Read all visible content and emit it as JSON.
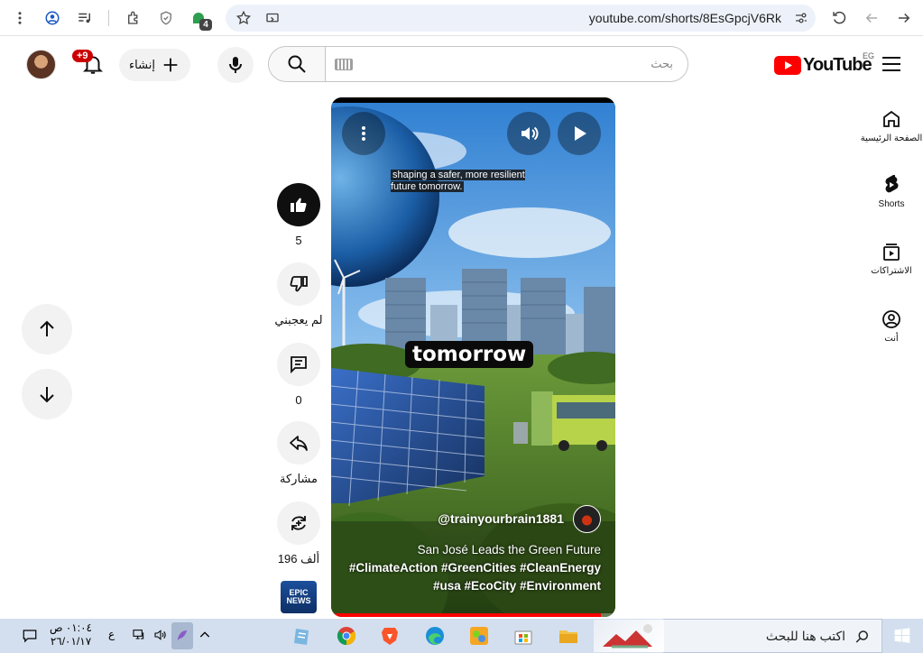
{
  "browser": {
    "url": "youtube.com/shorts/8EsGpcjV6Rk",
    "extension_badge": "4"
  },
  "header": {
    "notification_count": "+9",
    "create_label": "إنشاء",
    "search_placeholder": "بحث",
    "logo_text": "YouTube",
    "country_code": "EG"
  },
  "guide": [
    {
      "label": "الصفحة الرئيسية",
      "icon": "home-icon"
    },
    {
      "label": "Shorts",
      "icon": "shorts-icon"
    },
    {
      "label": "الاشتراكات",
      "icon": "subscriptions-icon"
    },
    {
      "label": "أنت",
      "icon": "you-icon"
    }
  ],
  "actions": {
    "like_count": "5",
    "dislike_label": "لم يعجبني",
    "comment_count": "0",
    "share_label": "مشاركة",
    "remix_count": "196 ألف",
    "thumb_text": [
      "EPIC",
      "NEWS"
    ]
  },
  "video": {
    "subtitle": "shaping a safer, more resilient future tomorrow.",
    "big_caption": "tomorrow",
    "channel": "@trainyourbrain1881",
    "title": "San José Leads the Green Future",
    "hashtags_line1": "#ClimateAction #GreenCities #CleanEnergy",
    "hashtags_line2": "#usa #EcoCity #Environment",
    "progress": 0.95
  },
  "taskbar": {
    "search_placeholder": "اكتب هنا للبحث",
    "time": "٠١:٠٤ ص",
    "date": "٢٦/٠١/١٧",
    "lang": "ع"
  },
  "colors": {
    "yt_red": "#ff0000",
    "taskbar_bg": "#d3dfee",
    "notif_red": "#cc0000"
  }
}
